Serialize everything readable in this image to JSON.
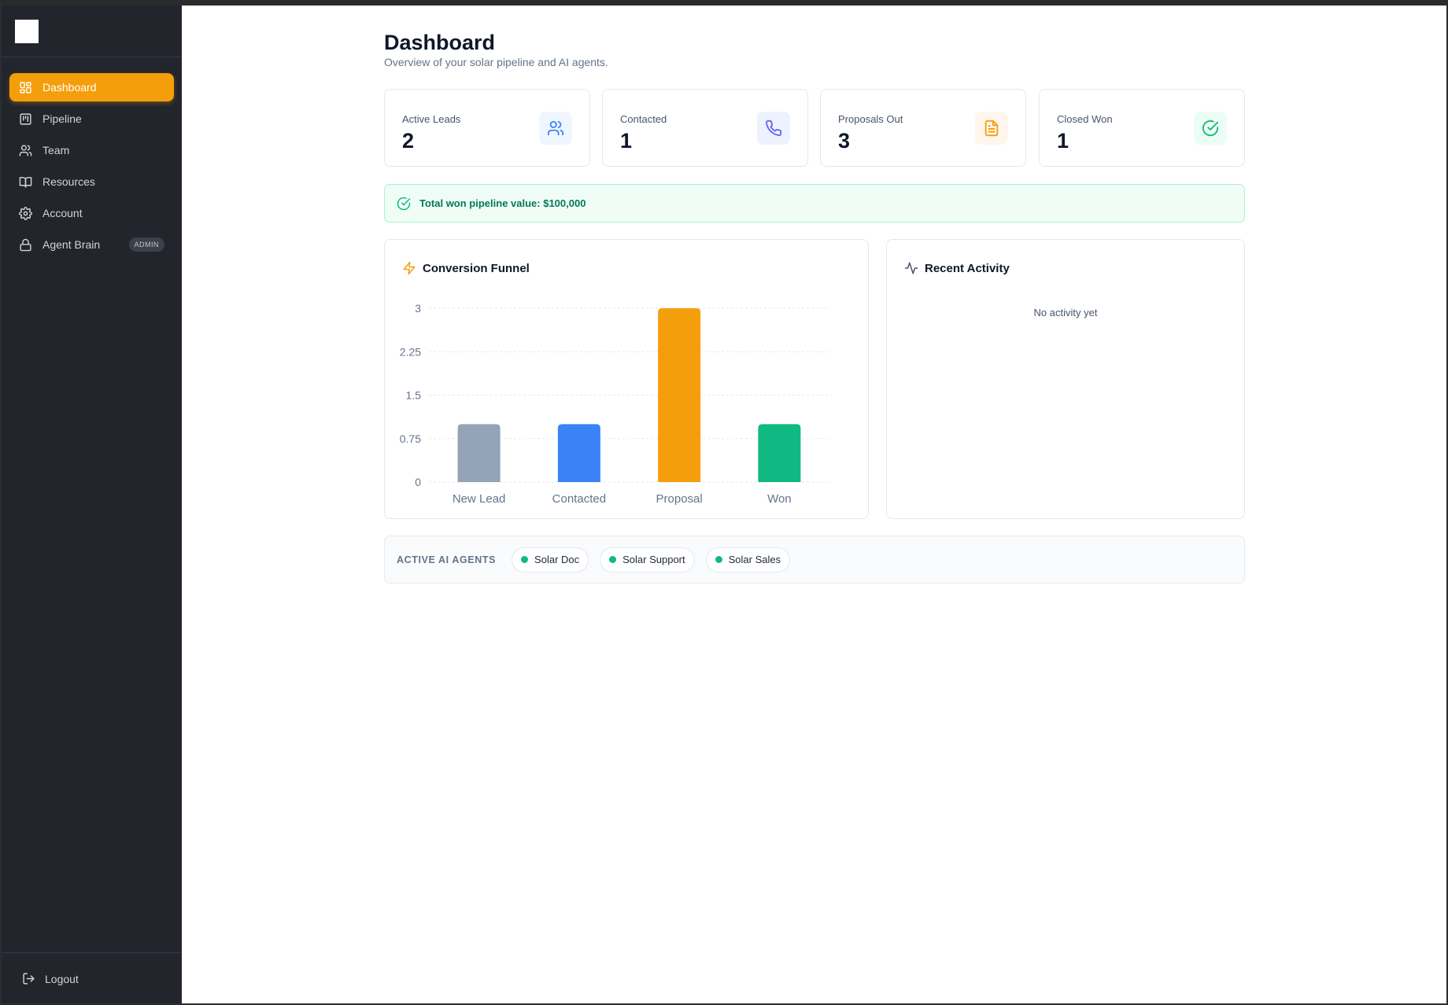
{
  "sidebar": {
    "items": [
      {
        "label": "Dashboard",
        "icon": "dashboard-icon",
        "active": true
      },
      {
        "label": "Pipeline",
        "icon": "pipeline-icon"
      },
      {
        "label": "Team",
        "icon": "team-icon"
      },
      {
        "label": "Resources",
        "icon": "book-icon"
      },
      {
        "label": "Account",
        "icon": "gear-icon"
      },
      {
        "label": "Agent Brain",
        "icon": "lock-icon",
        "badge": "ADMIN"
      }
    ],
    "logout": "Logout",
    "accent": "#f59e0b",
    "background": "#22252c"
  },
  "header": {
    "title": "Dashboard",
    "subtitle": "Overview of your solar pipeline and AI agents."
  },
  "stats": [
    {
      "label": "Active Leads",
      "value": "2",
      "icon": "users-icon",
      "color": "#3b82f6",
      "bg": "#eff6ff"
    },
    {
      "label": "Contacted",
      "value": "1",
      "icon": "phone-icon",
      "color": "#6366f1",
      "bg": "#eef2ff"
    },
    {
      "label": "Proposals Out",
      "value": "3",
      "icon": "document-icon",
      "color": "#f59e0b",
      "bg": "#fff7ed"
    },
    {
      "label": "Closed Won",
      "value": "1",
      "icon": "check-circle-icon",
      "color": "#10b981",
      "bg": "#ecfdf5"
    }
  ],
  "banner": {
    "text": "Total won pipeline value: $100,000",
    "icon": "check-circle-icon"
  },
  "funnel": {
    "title": "Conversion Funnel",
    "icon": "lightning-icon"
  },
  "activity": {
    "title": "Recent Activity",
    "icon": "activity-icon",
    "empty": "No activity yet"
  },
  "agents": {
    "label": "ACTIVE AI AGENTS",
    "items": [
      "Solar Doc",
      "Solar Support",
      "Solar Sales"
    ],
    "status_color": "#10b981"
  },
  "chart_data": {
    "type": "bar",
    "categories": [
      "New Lead",
      "Contacted",
      "Proposal",
      "Won"
    ],
    "values": [
      1,
      1,
      3,
      1
    ],
    "colors": [
      "#94a3b8",
      "#3b82f6",
      "#f59e0b",
      "#10b981"
    ],
    "yticks": [
      "0",
      "0.75",
      "1.5",
      "2.25",
      "3"
    ],
    "ylim": [
      0,
      3
    ],
    "grid": true
  }
}
